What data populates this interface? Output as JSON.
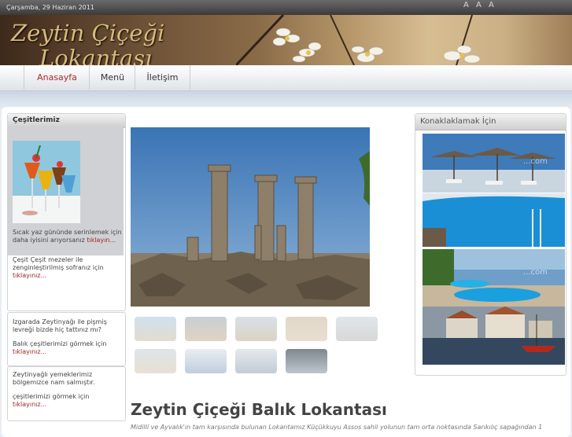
{
  "topbar": {
    "date": "Çarşamba, 29 Haziran 2011",
    "font_size_controls": "A A A"
  },
  "banner": {
    "line1": "Zeytin Çiçeği",
    "line2": "Lokantası"
  },
  "nav": {
    "items": [
      {
        "label": "Anasayfa",
        "active": true
      },
      {
        "label": "Menü",
        "active": false
      },
      {
        "label": "İletişim",
        "active": false
      }
    ]
  },
  "sidebar": {
    "title": "Çeşitlerimiz",
    "panels": [
      {
        "line1": "Sıcak yaz gününde serinlemek için",
        "line2": "daha iyisini arıyorsanız",
        "link": "tıklayın..."
      },
      {
        "line1": "Çeşit Çeşit mezeler ile",
        "line2": "zenginleştirilmiş sofranız için",
        "link": "tıklayınız..."
      },
      {
        "line1": "Izgarada Zeytinyağı ile pişmiş",
        "line2": "levreği bizde  hiç tattınız mı?",
        "line3": "Balık çeşitlerimizi görmek için",
        "link": "tıklayınız..."
      },
      {
        "line1": "Zeytinyağlı yemeklerimiz",
        "line2": "bölgemizce nam salmıştır.",
        "line3": "çeşitlerimizi görmek için",
        "link": "tıklayınız..."
      }
    ]
  },
  "accommodation": {
    "title": "Konaklaklamak İçin",
    "watermark1": "...com",
    "watermark2": "...com"
  },
  "main": {
    "title": "Zeytin Çiçeği Balık Lokantası",
    "intro": "Midilli ve Ayvalık'ın tam karşısında bulunan Lokantamız Küçükkuyu Assos sahil yolunun tam orta noktasında Sarıkılıç sapağından 1"
  },
  "colors": {
    "link": "#a02525",
    "active_nav": "#b02a2a",
    "title": "#444444"
  }
}
